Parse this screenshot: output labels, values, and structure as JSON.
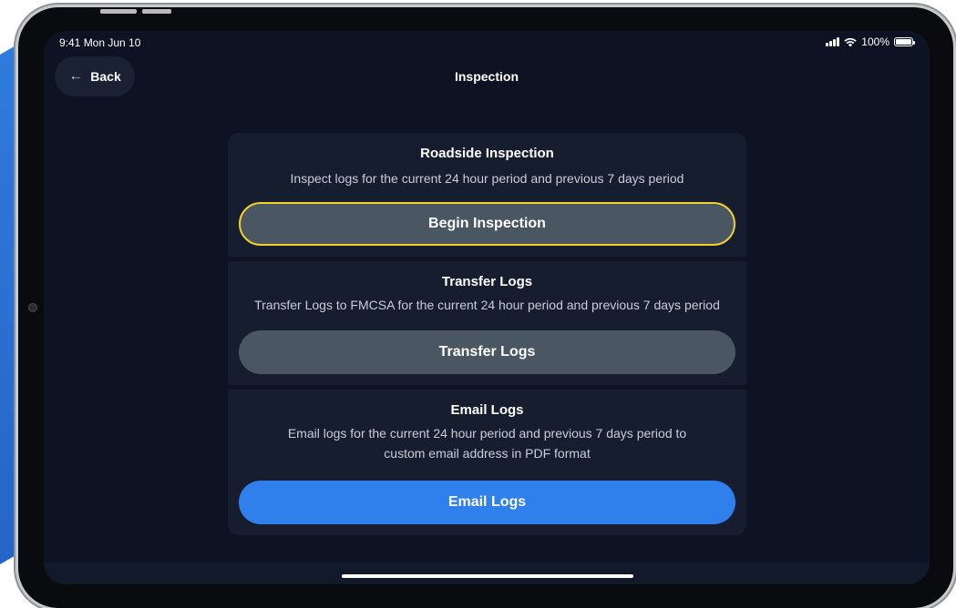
{
  "status_bar": {
    "time": "9:41  Mon Jun 10",
    "battery": "100%"
  },
  "header": {
    "back_label": "Back",
    "title": "Inspection"
  },
  "cards": [
    {
      "title": "Roadside Inspection",
      "description": "Inspect logs for the current 24 hour period and previous 7 days period",
      "button_label": "Begin Inspection"
    },
    {
      "title": "Transfer Logs",
      "description": "Transfer Logs to FMCSA for the current 24 hour period and previous 7 days period",
      "button_label": "Transfer Logs"
    },
    {
      "title": "Email Logs",
      "description": "Email logs for the current 24 hour period and previous 7 days period to custom email address in PDF format",
      "button_label": "Email Logs"
    }
  ],
  "colors": {
    "accent_blue": "#2f80ed",
    "focus_yellow": "#f2cf2a",
    "screen_bg": "#0d1322",
    "card_bg": "#161d2f",
    "secondary_button": "#4a5662"
  }
}
